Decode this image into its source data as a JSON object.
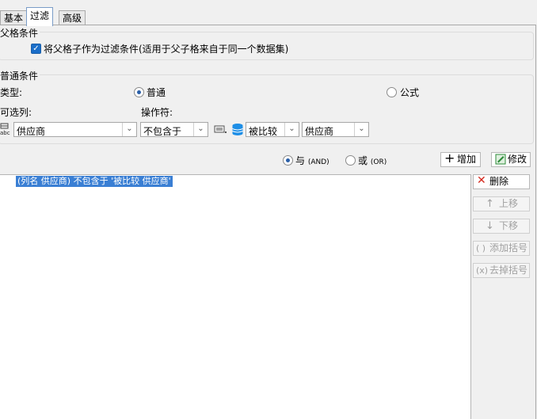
{
  "tabs": [
    {
      "label": "基本"
    },
    {
      "label": "过滤"
    },
    {
      "label": "高级"
    }
  ],
  "parent_section": {
    "title": "父格条件",
    "checkbox_label": "将父格子作为过滤条件(适用于父子格来自于同一个数据集)",
    "checked": true
  },
  "normal_section": {
    "title": "普通条件",
    "type_label": "类型:",
    "radio_normal": "普通",
    "radio_formula": "公式",
    "selected_type": "普通",
    "column_label": "可选列:",
    "operator_label": "操作符:",
    "column_value": "供应商",
    "operator_value": "不包含于",
    "compare_value": "被比较",
    "compare_field": "供应商"
  },
  "logic": {
    "and_main": "与",
    "and_sub": "(AND)",
    "or_main": "或",
    "or_sub": "(OR)",
    "selected": "AND"
  },
  "buttons": {
    "add": "增加",
    "modify": "修改",
    "delete": "删除",
    "move_up": "上移",
    "move_down": "下移",
    "add_bracket": "添加括号",
    "remove_bracket": "去掉括号"
  },
  "conditions": [
    {
      "text": "(列名 供应商) 不包含于 '被比较 供应商'",
      "selected": true
    }
  ],
  "colors": {
    "selection": "#3a7fd4",
    "checkbox": "#1a6ec9",
    "delete_icon": "#d4281c",
    "modify_icon": "#2e8b3a"
  }
}
